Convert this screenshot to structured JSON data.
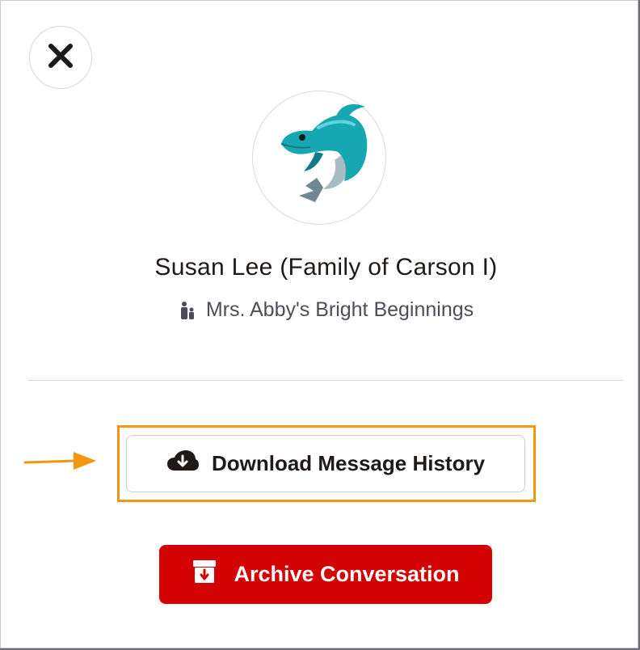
{
  "dialog": {
    "close_icon": "close-icon",
    "avatar_icon": "dolphin-emoji"
  },
  "contact": {
    "name": "Susan Lee (Family of Carson I)",
    "school_icon": "family-icon",
    "school": "Mrs. Abby's Bright Beginnings"
  },
  "actions": {
    "download_label": "Download Message History",
    "download_icon": "cloud-download-icon",
    "archive_label": "Archive Conversation",
    "archive_icon": "archive-box-icon"
  },
  "colors": {
    "highlight": "#f5960f",
    "archive": "#d40303",
    "text": "#1f1a17"
  }
}
